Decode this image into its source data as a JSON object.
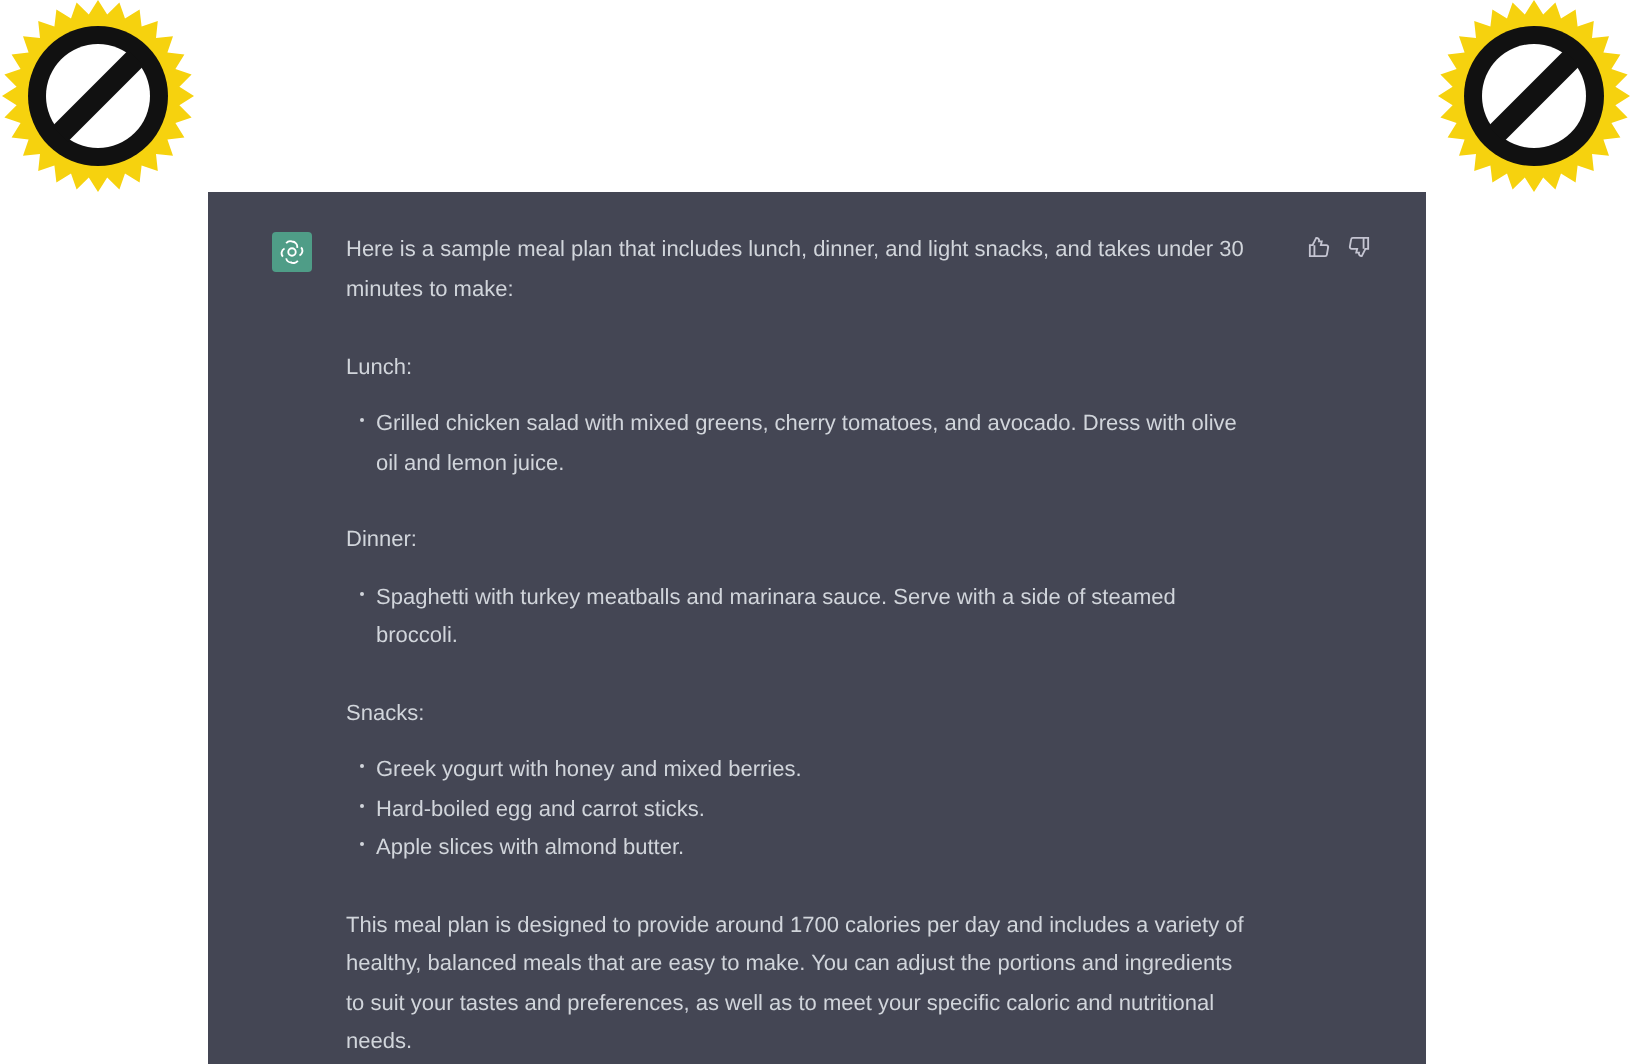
{
  "stickers": [
    {
      "kind": "prohibition"
    },
    {
      "kind": "prohibition"
    }
  ],
  "message": {
    "intro": "Here is a sample meal plan that includes lunch, dinner, and light snacks, and takes under 30 minutes to make:",
    "sections": [
      {
        "heading": "Lunch:",
        "items": [
          "Grilled chicken salad with mixed greens, cherry tomatoes, and avocado. Dress with olive oil and lemon juice."
        ]
      },
      {
        "heading": "Dinner:",
        "items": [
          "Spaghetti with turkey meatballs and marinara sauce. Serve with a side of steamed broccoli."
        ]
      },
      {
        "heading": "Snacks:",
        "items": [
          "Greek yogurt with honey and mixed berries.",
          "Hard-boiled egg and carrot sticks.",
          "Apple slices with almond butter."
        ]
      }
    ],
    "closing": "This meal plan is designed to provide around 1700 calories per day and includes a variety of healthy, balanced meals that are easy to make. You can adjust the portions and ingredients to suit your tastes and preferences, as well as to meet your specific caloric and nutritional needs."
  }
}
